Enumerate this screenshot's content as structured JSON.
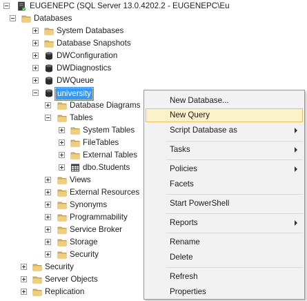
{
  "tree": {
    "server": "EUGENEPC (SQL Server 13.0.4202.2 - EUGENEPC\\Eu",
    "databases": "Databases",
    "system_databases": "System Databases",
    "database_snapshots": "Database Snapshots",
    "db_configuration": "DWConfiguration",
    "db_diagnostics": "DWDiagnostics",
    "db_queue": "DWQueue",
    "db_university": "university",
    "database_diagrams": "Database Diagrams",
    "tables": "Tables",
    "system_tables": "System Tables",
    "file_tables": "FileTables",
    "external_tables": "External Tables",
    "dbo_students": "dbo.Students",
    "views": "Views",
    "external_resources": "External Resources",
    "synonyms": "Synonyms",
    "programmability": "Programmability",
    "service_broker": "Service Broker",
    "storage": "Storage",
    "security_db": "Security",
    "security": "Security",
    "server_objects": "Server Objects",
    "replication": "Replication"
  },
  "context_menu": {
    "new_database": "New Database...",
    "new_query": "New Query",
    "script_database_as": "Script Database as",
    "tasks": "Tasks",
    "policies": "Policies",
    "facets": "Facets",
    "start_powershell": "Start PowerShell",
    "reports": "Reports",
    "rename": "Rename",
    "delete": "Delete",
    "refresh": "Refresh",
    "properties": "Properties"
  },
  "colors": {
    "selection": "#3399ff",
    "menu_highlight": "#fcf1c8",
    "folder": "#dcb35c"
  },
  "icons": {
    "server": "server-icon",
    "folder": "folder-icon",
    "database": "database-icon",
    "table": "table-icon"
  }
}
